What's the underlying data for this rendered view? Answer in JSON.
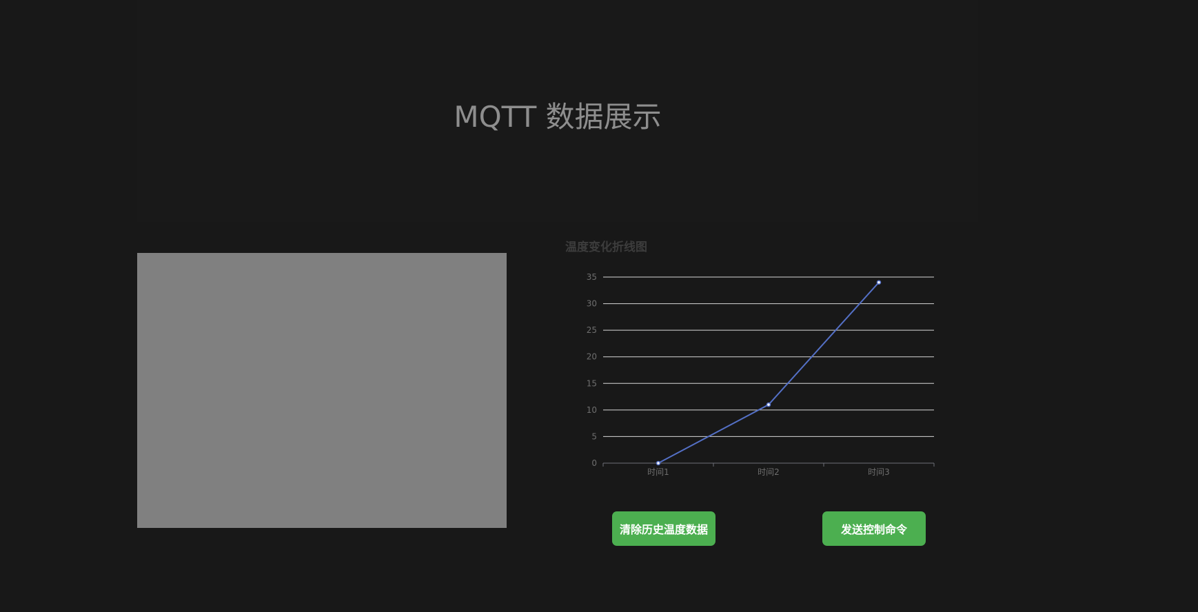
{
  "header": {
    "title": "MQTT 数据展示"
  },
  "video": {
    "placeholder_color": "#808080"
  },
  "chart_data": {
    "type": "line",
    "title": "温度变化折线图",
    "categories": [
      "时间1",
      "时间2",
      "时间3"
    ],
    "series": [
      {
        "values": [
          0,
          11,
          34
        ],
        "color": "#5470c6"
      }
    ],
    "ylim": [
      0,
      35
    ],
    "yticks": [
      0,
      5,
      10,
      15,
      20,
      25,
      30,
      35
    ],
    "grid": true
  },
  "buttons": {
    "clear_label": "清除历史温度数据",
    "send_label": "发送控制命令"
  },
  "colors": {
    "background": "#181818",
    "button": "#4caf50",
    "line": "#5470c6"
  }
}
